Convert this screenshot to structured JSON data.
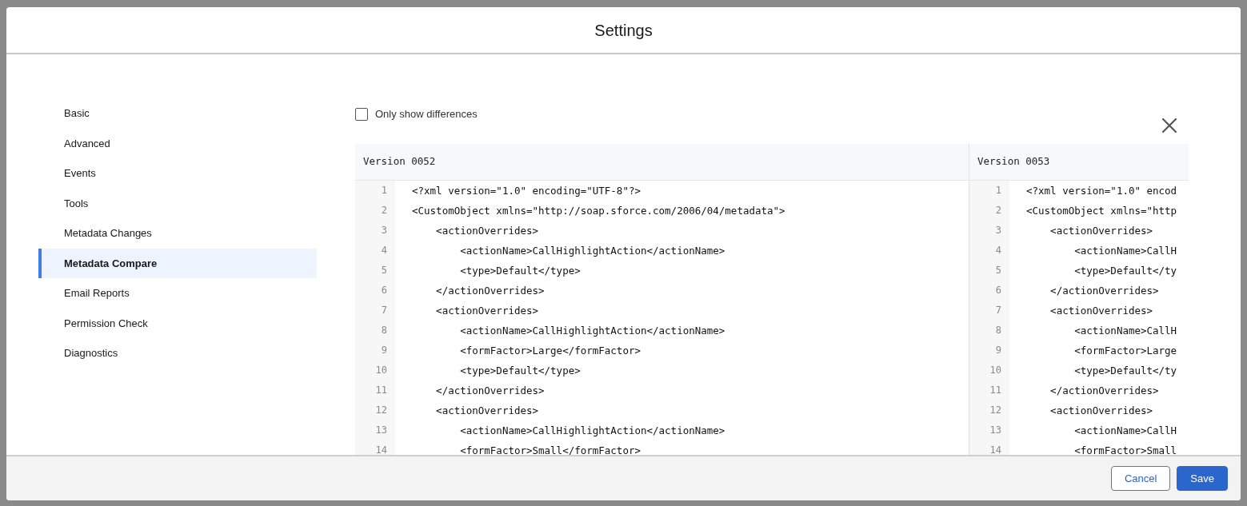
{
  "dialog": {
    "title": "Settings"
  },
  "sidebar": {
    "items": [
      {
        "label": "Basic",
        "selected": false
      },
      {
        "label": "Advanced",
        "selected": false
      },
      {
        "label": "Events",
        "selected": false
      },
      {
        "label": "Tools",
        "selected": false
      },
      {
        "label": "Metadata Changes",
        "selected": false
      },
      {
        "label": "Metadata Compare",
        "selected": true
      },
      {
        "label": "Email Reports",
        "selected": false
      },
      {
        "label": "Permission Check",
        "selected": false
      },
      {
        "label": "Diagnostics",
        "selected": false
      }
    ]
  },
  "only_show_differences": {
    "label": "Only show differences",
    "checked": false
  },
  "diff": {
    "panes": [
      {
        "title": "Version 0052",
        "lines": [
          {
            "number": "1",
            "text": "<?xml version=\"1.0\" encoding=\"UTF-8\"?>"
          },
          {
            "number": "2",
            "text": "<CustomObject xmlns=\"http://soap.sforce.com/2006/04/metadata\">"
          },
          {
            "number": "3",
            "text": "    <actionOverrides>"
          },
          {
            "number": "4",
            "text": "        <actionName>CallHighlightAction</actionName>"
          },
          {
            "number": "5",
            "text": "        <type>Default</type>"
          },
          {
            "number": "6",
            "text": "    </actionOverrides>"
          },
          {
            "number": "7",
            "text": "    <actionOverrides>"
          },
          {
            "number": "8",
            "text": "        <actionName>CallHighlightAction</actionName>"
          },
          {
            "number": "9",
            "text": "        <formFactor>Large</formFactor>"
          },
          {
            "number": "10",
            "text": "        <type>Default</type>"
          },
          {
            "number": "11",
            "text": "    </actionOverrides>"
          },
          {
            "number": "12",
            "text": "    <actionOverrides>"
          },
          {
            "number": "13",
            "text": "        <actionName>CallHighlightAction</actionName>"
          },
          {
            "number": "14",
            "text": "        <formFactor>Small</formFactor>"
          }
        ]
      },
      {
        "title": "Version 0053",
        "lines": [
          {
            "number": "1",
            "text": "<?xml version=\"1.0\" encod"
          },
          {
            "number": "2",
            "text": "<CustomObject xmlns=\"http"
          },
          {
            "number": "3",
            "text": "    <actionOverrides>"
          },
          {
            "number": "4",
            "text": "        <actionName>CallH"
          },
          {
            "number": "5",
            "text": "        <type>Default</ty"
          },
          {
            "number": "6",
            "text": "    </actionOverrides>"
          },
          {
            "number": "7",
            "text": "    <actionOverrides>"
          },
          {
            "number": "8",
            "text": "        <actionName>CallH"
          },
          {
            "number": "9",
            "text": "        <formFactor>Large"
          },
          {
            "number": "10",
            "text": "        <type>Default</ty"
          },
          {
            "number": "11",
            "text": "    </actionOverrides>"
          },
          {
            "number": "12",
            "text": "    <actionOverrides>"
          },
          {
            "number": "13",
            "text": "        <actionName>CallH"
          },
          {
            "number": "14",
            "text": "        <formFactor>Small"
          }
        ]
      }
    ]
  },
  "footer": {
    "buttons": [
      {
        "label": "Cancel",
        "kind": "secondary"
      },
      {
        "label": "Save",
        "kind": "primary"
      }
    ]
  }
}
